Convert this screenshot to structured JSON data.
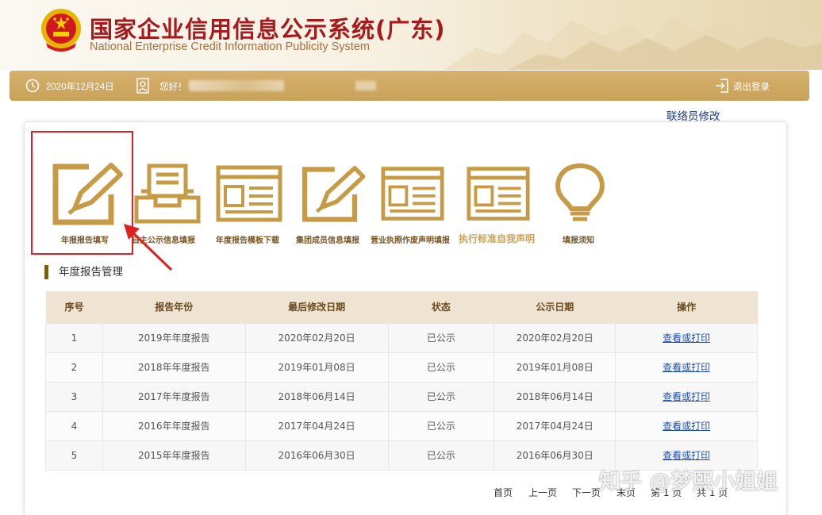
{
  "header": {
    "title": "国家企业信用信息公示系统(广东)",
    "subtitle": "National Enterprise Credit Information Publicity System"
  },
  "toolbar": {
    "date": "2020年12月24日",
    "greeting": "您好！",
    "logout_label": "退出登录"
  },
  "contact_link": "联络员修改",
  "icons": [
    {
      "label": "年报报告填写",
      "icon": "edit-pencil-icon"
    },
    {
      "label": "自主公示信息填报",
      "icon": "inbox-tray-icon"
    },
    {
      "label": "年度报告模板下载",
      "icon": "template-document-icon"
    },
    {
      "label": "集团成员信息填报",
      "icon": "edit-pencil-icon"
    },
    {
      "label": "营业执照作废声明填报",
      "icon": "form-document-icon"
    },
    {
      "label": "执行标准自我声明",
      "icon": "form-document-icon"
    },
    {
      "label": "填报须知",
      "icon": "lightbulb-icon"
    }
  ],
  "section_title": "年度报告管理",
  "table": {
    "headers": [
      "序号",
      "报告年份",
      "最后修改日期",
      "状态",
      "公示日期",
      "操作"
    ],
    "rows": [
      [
        "1",
        "2019年年度报告",
        "2020年02月20日",
        "已公示",
        "2020年02月20日",
        "查看或打印"
      ],
      [
        "2",
        "2018年年度报告",
        "2019年01月08日",
        "已公示",
        "2019年01月08日",
        "查看或打印"
      ],
      [
        "3",
        "2017年年度报告",
        "2018年06月14日",
        "已公示",
        "2018年06月14日",
        "查看或打印"
      ],
      [
        "4",
        "2016年年度报告",
        "2017年04月24日",
        "已公示",
        "2017年04月24日",
        "查看或打印"
      ],
      [
        "5",
        "2015年年度报告",
        "2016年06月30日",
        "已公示",
        "2016年06月30日",
        "查看或打印"
      ]
    ]
  },
  "pagination": {
    "first": "首页",
    "prev": "上一页",
    "next": "下一页",
    "last": "末页",
    "page": "第 1 页",
    "total": "共 1 页"
  },
  "watermark": "知乎 @梦熙小姐姐",
  "colors": {
    "brand_red": "#a8191c",
    "gold": "#c9a159",
    "icon_gold": "#c79b45",
    "highlight_red": "#e02020",
    "link_blue": "#1e4fb0"
  }
}
